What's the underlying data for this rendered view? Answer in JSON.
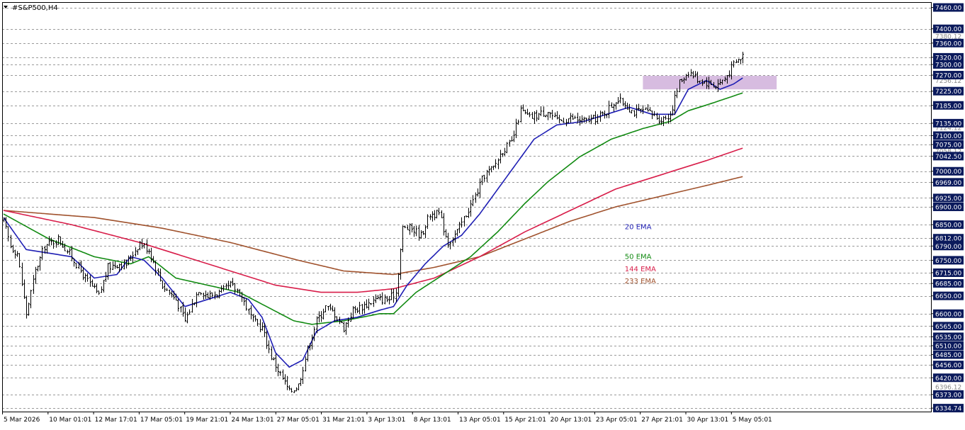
{
  "header": {
    "symbol_label": "#S&P500,H4",
    "menu_arrow": "down-triangle"
  },
  "colors": {
    "background": "#ffffff",
    "grid": "#9a9a9a",
    "candle": "#000000",
    "ema20": "#1f1fb4",
    "ema50": "#118a11",
    "ema144": "#d81e4a",
    "ema233": "#a0522d",
    "zone": "#c9a6d6",
    "price_tag_bg": "#0b1a5c",
    "price_tag_text": "#ffffff"
  },
  "chart_data": {
    "type": "candlestick",
    "title": "#S&P500,H4",
    "ylim": [
      6325,
      7475
    ],
    "x_tick_labels": [
      "5 Mar 2026",
      "10 Mar 01:01",
      "12 Mar 17:01",
      "17 Mar 05:01",
      "19 Mar 21:01",
      "24 Mar 13:01",
      "27 Mar 05:01",
      "31 Mar 21:01",
      "3 Apr 13:01",
      "8 Apr 13:01",
      "13 Apr 05:01",
      "15 Apr 21:01",
      "20 Apr 13:01",
      "23 Apr 05:01",
      "27 Apr 21:01",
      "30 Apr 13:01",
      "5 May 05:01"
    ],
    "price_levels": [
      7460.0,
      7400.0,
      7360.0,
      7320.0,
      7300.0,
      7270.0,
      7225.0,
      7185.0,
      7135.0,
      7100.0,
      7075.0,
      7042.5,
      7000.0,
      6969.0,
      6925.0,
      6900.0,
      6850.0,
      6812.0,
      6790.0,
      6750.0,
      6715.0,
      6685.0,
      6650.0,
      6600.0,
      6565.0,
      6535.0,
      6510.0,
      6485.0,
      6456.0,
      6420.0,
      6373.0,
      6334.74
    ],
    "price_tags": [
      {
        "label": "7460.00",
        "value": 7460.0
      },
      {
        "label": "7400.00",
        "value": 7400.0
      },
      {
        "label": "7360.00",
        "value": 7360.0
      },
      {
        "label": "7320.00",
        "value": 7320.0
      },
      {
        "label": "7300.00",
        "value": 7300.0
      },
      {
        "label": "7270.00",
        "value": 7270.0
      },
      {
        "label": "7225.00",
        "value": 7225.0
      },
      {
        "label": "7185.00",
        "value": 7185.0
      },
      {
        "label": "7135.00",
        "value": 7135.0
      },
      {
        "label": "7100.00",
        "value": 7100.0
      },
      {
        "label": "7075.00",
        "value": 7075.0
      },
      {
        "label": "7042.50",
        "value": 7042.5
      },
      {
        "label": "7000.00",
        "value": 7000.0
      },
      {
        "label": "6969.00",
        "value": 6969.0
      },
      {
        "label": "6925.00",
        "value": 6925.0
      },
      {
        "label": "6900.00",
        "value": 6900.0
      },
      {
        "label": "6850.00",
        "value": 6850.0
      },
      {
        "label": "6812.00",
        "value": 6812.0
      },
      {
        "label": "6790.00",
        "value": 6790.0
      },
      {
        "label": "6750.00",
        "value": 6750.0
      },
      {
        "label": "6715.00",
        "value": 6715.0
      },
      {
        "label": "6685.00",
        "value": 6685.0
      },
      {
        "label": "6650.00",
        "value": 6650.0
      },
      {
        "label": "6600.00",
        "value": 6600.0
      },
      {
        "label": "6565.00",
        "value": 6565.0
      },
      {
        "label": "6535.00",
        "value": 6535.0
      },
      {
        "label": "6510.00",
        "value": 6510.0
      },
      {
        "label": "6485.00",
        "value": 6485.0
      },
      {
        "label": "6456.00",
        "value": 6456.0
      },
      {
        "label": "6420.00",
        "value": 6420.0
      },
      {
        "label": "6373.00",
        "value": 6373.0
      },
      {
        "label": "6334.74",
        "value": 6334.74
      }
    ],
    "faint_price_labels": [
      {
        "label": "7380.12",
        "value": 7380.12
      },
      {
        "label": "7256.12",
        "value": 7256.12
      },
      {
        "label": "7124.12",
        "value": 7124.12
      },
      {
        "label": "7058.12",
        "value": 7058.12
      },
      {
        "label": "6396.12",
        "value": 6396.12
      }
    ],
    "zone": {
      "x_start": 282,
      "x_end": 341,
      "y_low": 7230,
      "y_high": 7268
    },
    "ema_labels": [
      {
        "text": "20 EMA",
        "series": "ema20",
        "x": 274,
        "y": 6845
      },
      {
        "text": "50 EMA",
        "series": "ema50",
        "x": 274,
        "y": 6762
      },
      {
        "text": "144 EMA",
        "series": "ema144",
        "x": 274,
        "y": 6727
      },
      {
        "text": "233 EMA",
        "series": "ema233",
        "x": 274,
        "y": 6693
      }
    ],
    "close_anchors": [
      [
        0,
        6860
      ],
      [
        3,
        6790
      ],
      [
        6,
        6770
      ],
      [
        10,
        6600
      ],
      [
        14,
        6720
      ],
      [
        18,
        6790
      ],
      [
        24,
        6810
      ],
      [
        30,
        6760
      ],
      [
        36,
        6700
      ],
      [
        42,
        6650
      ],
      [
        46,
        6730
      ],
      [
        50,
        6740
      ],
      [
        54,
        6740
      ],
      [
        60,
        6800
      ],
      [
        64,
        6780
      ],
      [
        70,
        6680
      ],
      [
        76,
        6640
      ],
      [
        80,
        6580
      ],
      [
        86,
        6670
      ],
      [
        90,
        6650
      ],
      [
        96,
        6660
      ],
      [
        100,
        6680
      ],
      [
        104,
        6660
      ],
      [
        110,
        6580
      ],
      [
        114,
        6560
      ],
      [
        118,
        6480
      ],
      [
        122,
        6430
      ],
      [
        126,
        6380
      ],
      [
        130,
        6400
      ],
      [
        134,
        6500
      ],
      [
        138,
        6580
      ],
      [
        142,
        6620
      ],
      [
        146,
        6600
      ],
      [
        150,
        6560
      ],
      [
        154,
        6610
      ],
      [
        158,
        6620
      ],
      [
        164,
        6640
      ],
      [
        170,
        6640
      ],
      [
        173,
        6660
      ],
      [
        176,
        6840
      ],
      [
        180,
        6840
      ],
      [
        184,
        6820
      ],
      [
        188,
        6880
      ],
      [
        192,
        6880
      ],
      [
        196,
        6800
      ],
      [
        200,
        6830
      ],
      [
        204,
        6880
      ],
      [
        208,
        6930
      ],
      [
        212,
        6990
      ],
      [
        216,
        7010
      ],
      [
        220,
        7060
      ],
      [
        224,
        7080
      ],
      [
        228,
        7170
      ],
      [
        232,
        7150
      ],
      [
        236,
        7160
      ],
      [
        240,
        7170
      ],
      [
        244,
        7140
      ],
      [
        250,
        7150
      ],
      [
        256,
        7140
      ],
      [
        262,
        7150
      ],
      [
        266,
        7170
      ],
      [
        270,
        7200
      ],
      [
        274,
        7190
      ],
      [
        278,
        7165
      ],
      [
        282,
        7170
      ],
      [
        286,
        7160
      ],
      [
        290,
        7145
      ],
      [
        294,
        7160
      ],
      [
        298,
        7250
      ],
      [
        302,
        7280
      ],
      [
        306,
        7260
      ],
      [
        310,
        7250
      ],
      [
        314,
        7240
      ],
      [
        318,
        7260
      ],
      [
        322,
        7300
      ],
      [
        326,
        7325
      ]
    ],
    "ema20_anchors": [
      [
        0,
        6870
      ],
      [
        10,
        6780
      ],
      [
        20,
        6770
      ],
      [
        30,
        6760
      ],
      [
        40,
        6700
      ],
      [
        50,
        6710
      ],
      [
        56,
        6760
      ],
      [
        62,
        6750
      ],
      [
        70,
        6700
      ],
      [
        80,
        6620
      ],
      [
        90,
        6640
      ],
      [
        100,
        6660
      ],
      [
        108,
        6640
      ],
      [
        114,
        6590
      ],
      [
        120,
        6490
      ],
      [
        126,
        6450
      ],
      [
        132,
        6470
      ],
      [
        138,
        6550
      ],
      [
        146,
        6580
      ],
      [
        156,
        6590
      ],
      [
        166,
        6610
      ],
      [
        172,
        6620
      ],
      [
        178,
        6680
      ],
      [
        186,
        6740
      ],
      [
        194,
        6790
      ],
      [
        202,
        6820
      ],
      [
        210,
        6880
      ],
      [
        218,
        6950
      ],
      [
        226,
        7020
      ],
      [
        234,
        7090
      ],
      [
        244,
        7130
      ],
      [
        256,
        7140
      ],
      [
        266,
        7160
      ],
      [
        276,
        7180
      ],
      [
        286,
        7160
      ],
      [
        296,
        7160
      ],
      [
        302,
        7230
      ],
      [
        310,
        7255
      ],
      [
        316,
        7230
      ],
      [
        322,
        7245
      ],
      [
        326,
        7262
      ]
    ],
    "ema50_anchors": [
      [
        0,
        6880
      ],
      [
        20,
        6810
      ],
      [
        40,
        6760
      ],
      [
        56,
        6740
      ],
      [
        64,
        6760
      ],
      [
        76,
        6700
      ],
      [
        90,
        6680
      ],
      [
        104,
        6660
      ],
      [
        116,
        6620
      ],
      [
        128,
        6580
      ],
      [
        136,
        6570
      ],
      [
        150,
        6580
      ],
      [
        166,
        6600
      ],
      [
        172,
        6600
      ],
      [
        182,
        6660
      ],
      [
        194,
        6710
      ],
      [
        206,
        6760
      ],
      [
        218,
        6830
      ],
      [
        230,
        6910
      ],
      [
        240,
        6970
      ],
      [
        254,
        7040
      ],
      [
        268,
        7090
      ],
      [
        282,
        7120
      ],
      [
        294,
        7140
      ],
      [
        302,
        7170
      ],
      [
        312,
        7190
      ],
      [
        326,
        7220
      ]
    ],
    "ema144_anchors": [
      [
        0,
        6890
      ],
      [
        30,
        6850
      ],
      [
        60,
        6800
      ],
      [
        80,
        6760
      ],
      [
        100,
        6720
      ],
      [
        120,
        6680
      ],
      [
        140,
        6660
      ],
      [
        156,
        6660
      ],
      [
        172,
        6670
      ],
      [
        190,
        6700
      ],
      [
        210,
        6760
      ],
      [
        230,
        6830
      ],
      [
        250,
        6890
      ],
      [
        270,
        6950
      ],
      [
        290,
        6990
      ],
      [
        310,
        7030
      ],
      [
        326,
        7065
      ]
    ],
    "ema233_anchors": [
      [
        0,
        6890
      ],
      [
        40,
        6870
      ],
      [
        70,
        6840
      ],
      [
        100,
        6800
      ],
      [
        130,
        6750
      ],
      [
        150,
        6720
      ],
      [
        172,
        6710
      ],
      [
        190,
        6730
      ],
      [
        210,
        6760
      ],
      [
        230,
        6810
      ],
      [
        250,
        6860
      ],
      [
        270,
        6900
      ],
      [
        290,
        6930
      ],
      [
        310,
        6960
      ],
      [
        326,
        6985
      ]
    ],
    "bars_count": 327,
    "seed": 17
  }
}
